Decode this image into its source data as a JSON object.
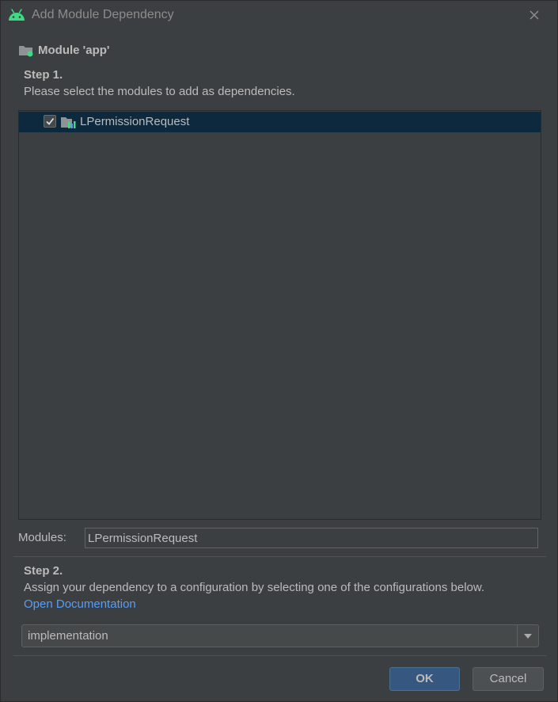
{
  "window": {
    "title": "Add Module Dependency",
    "app_icon": "android-icon",
    "close_icon": "close-icon"
  },
  "module": {
    "title": "Module 'app'",
    "icon": "module-folder-icon"
  },
  "step1": {
    "heading": "Step 1.",
    "description": "Please select the modules to add as dependencies."
  },
  "module_list": {
    "items": [
      {
        "label": "LPermissionRequest",
        "checked": true,
        "icon": "library-module-icon"
      }
    ]
  },
  "modules_field": {
    "label": "Modules:",
    "value": "LPermissionRequest"
  },
  "step2": {
    "heading": "Step 2.",
    "description": "Assign your dependency to a configuration by selecting one of the configurations below.",
    "link": "Open Documentation"
  },
  "configuration": {
    "selected": "implementation"
  },
  "buttons": {
    "ok": "OK",
    "cancel": "Cancel"
  },
  "colors": {
    "background": "#3c3f41",
    "selection": "#0d293e",
    "link": "#589df6",
    "primary_button": "#365880",
    "android_green": "#3ddc84"
  }
}
